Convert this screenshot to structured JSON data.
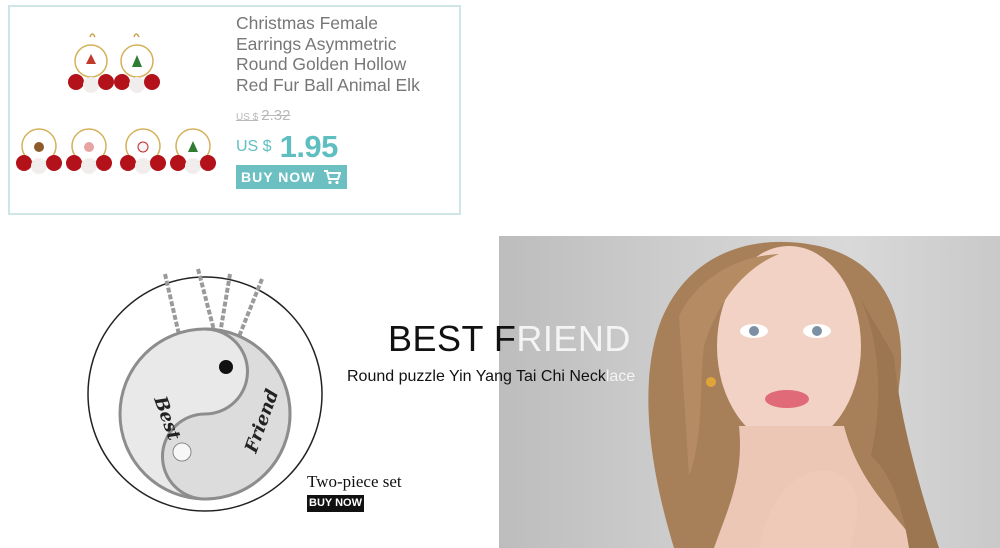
{
  "product": {
    "title_lines": [
      "Christmas Female",
      "Earrings Asymmetric",
      "Round Golden Hollow",
      "Red Fur Ball Animal Elk"
    ],
    "old_price_currency": "US $",
    "old_price": "2.32",
    "price_currency": "US $",
    "price": "1.95",
    "buy_label": "BUY NOW",
    "accent_color": "#6cc0c2"
  },
  "banner": {
    "title_head": "BEST F",
    "title_tail": "RIEND",
    "subtitle_head": "Round puzzle Yin Yang Tai Chi Neck",
    "subtitle_tail": "lace",
    "pendant_left_text": "Best",
    "pendant_right_text": "Friend",
    "set_label": "Two-piece set",
    "buy_label": "BUY NOW"
  }
}
